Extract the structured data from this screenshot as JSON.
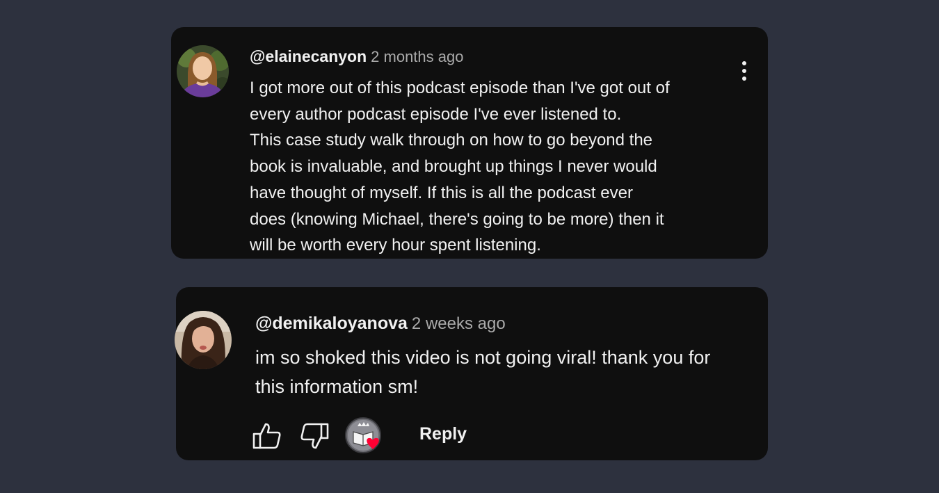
{
  "comments": [
    {
      "handle": "@elainecanyon",
      "time": "2 months ago",
      "lines": [
        "I got more out of this podcast episode than I've got out of",
        "every author podcast episode I've ever listened to.",
        "This case study walk through on how to go beyond the",
        "book is invaluable, and brought up things I never would",
        "have thought of myself. If this is all the podcast ever",
        "does (knowing Michael, there's going to be more) then it",
        "will be worth every hour spent listening."
      ]
    },
    {
      "handle": "@demikaloyanova",
      "time": "2 weeks ago",
      "lines": [
        "im so shoked this video is not going viral! thank you for",
        "this information sm!"
      ],
      "actions": {
        "reply_label": "Reply"
      }
    }
  ],
  "icons": {
    "menu": "more-vertical-icon",
    "like": "thumbs-up-icon",
    "dislike": "thumbs-down-icon",
    "creator_heart": "creator-heart-icon"
  },
  "colors": {
    "page_bg": "#2d313e",
    "card_bg": "#0f0f0f",
    "text": "#f1f1f1",
    "muted": "#aaaaaa",
    "heart": "#ff0033"
  }
}
